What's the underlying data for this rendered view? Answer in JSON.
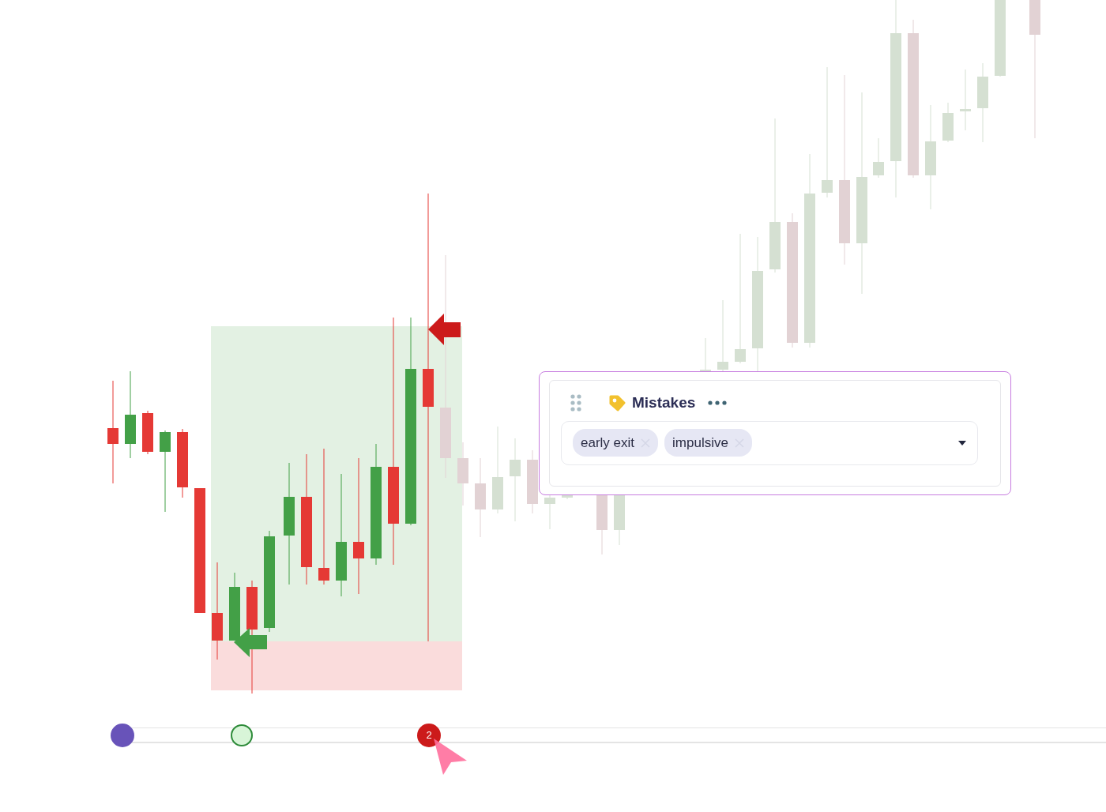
{
  "card": {
    "title": "Mistakes",
    "tags": [
      {
        "label": "early exit"
      },
      {
        "label": "impulsive"
      }
    ]
  },
  "timeline": {
    "markers": [
      {
        "kind": "dot",
        "color": "#6853b9"
      },
      {
        "kind": "ring",
        "color": "#2e8b3a"
      },
      {
        "kind": "count",
        "label": "2",
        "color": "#cc1a1a"
      }
    ]
  }
}
